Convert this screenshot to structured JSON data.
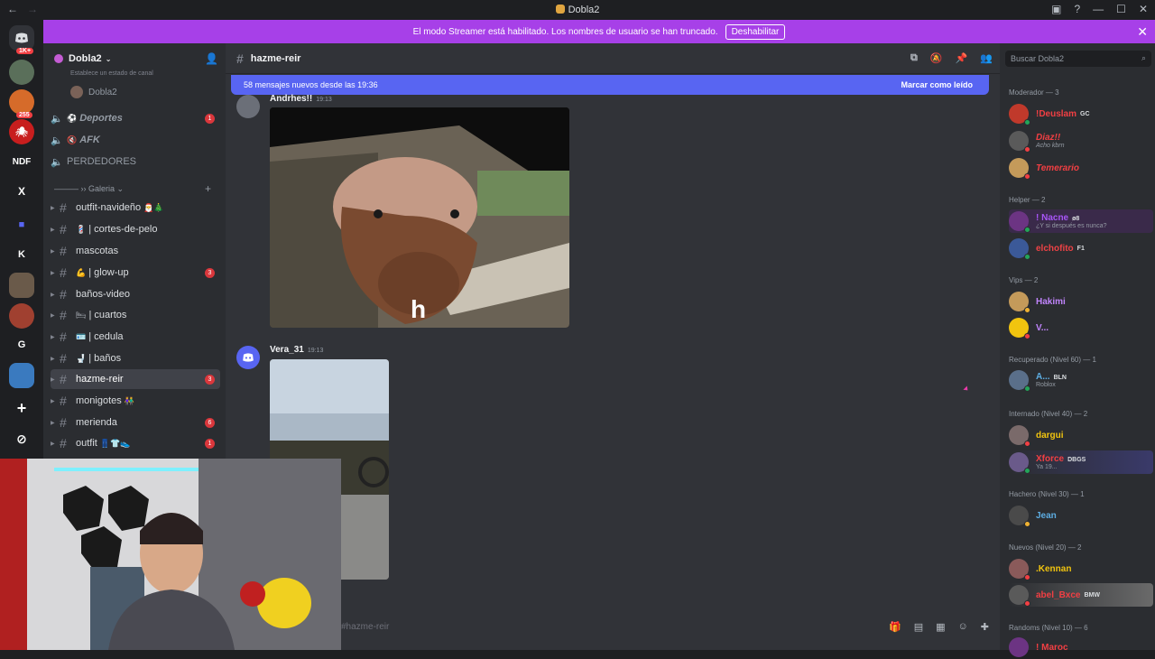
{
  "window": {
    "title": "Dobla2",
    "nav_back": "←",
    "nav_forward": "→"
  },
  "banner": {
    "text": "El modo Streamer está habilitado. Los nombres de usuario se han truncado.",
    "button": "Deshabilitar",
    "close": "✕"
  },
  "guilds": {
    "badges": [
      "1K+",
      "255"
    ],
    "letters": [
      "NDF",
      "X",
      "K",
      "G"
    ],
    "add": "+",
    "explore": "⊘"
  },
  "sidebar": {
    "server_name": "Dobla2",
    "status_hint": "Establece un estado de canal",
    "user": "Dobla2",
    "voice_channels": [
      {
        "label": "Deportes",
        "count": "1"
      },
      {
        "label": "AFK",
        "count": ""
      },
      {
        "label": "PERDEDORES",
        "count": ""
      }
    ],
    "category": "——— ›› Galeria",
    "channels": [
      {
        "label": "outfit-navideño",
        "emoji": "",
        "count": ""
      },
      {
        "label": "| cortes-de-pelo",
        "emoji": "💈",
        "count": ""
      },
      {
        "label": "mascotas",
        "emoji": "",
        "count": ""
      },
      {
        "label": "| glow-up",
        "emoji": "💪",
        "count": "3"
      },
      {
        "label": "baños-video",
        "emoji": "",
        "count": ""
      },
      {
        "label": "| cuartos",
        "emoji": "🛏",
        "count": ""
      },
      {
        "label": "| cedula",
        "emoji": "🪪",
        "count": ""
      },
      {
        "label": "| baños",
        "emoji": "🚽",
        "count": ""
      },
      {
        "label": "hazme-reir",
        "emoji": "",
        "count": "3"
      },
      {
        "label": "monigotes",
        "emoji": "",
        "count": ""
      },
      {
        "label": "merienda",
        "emoji": "",
        "count": "6"
      },
      {
        "label": "outfit",
        "emoji": "",
        "count": "1"
      }
    ]
  },
  "main": {
    "channel": "hazme-reir",
    "new_messages": "58 mensajes nuevos desde las 19:36",
    "mark_read": "Marcar como leído",
    "messages": [
      {
        "author": "Andrhes!!",
        "time": "19:13",
        "caption": "h"
      },
      {
        "author": "Vera_31",
        "time": "19:13"
      }
    ],
    "input_placeholder": "#hazme-reir"
  },
  "members": {
    "search_placeholder": "Buscar Dobla2",
    "groups": [
      {
        "title": "Moderador — 3"
      },
      {
        "title": "Helper — 2"
      },
      {
        "title": "Vips — 2"
      },
      {
        "title": "Recuperado (Nivel 60) — 1"
      },
      {
        "title": "Internado (Nivel 40) — 2"
      },
      {
        "title": "Hachero (Nivel 30) — 1"
      },
      {
        "title": "Nuevos (Nivel 20) — 2"
      },
      {
        "title": "Randoms (Nivel 10) — 6"
      }
    ],
    "list": [
      {
        "name": "!Deuslam",
        "tag": "GC",
        "sub": "",
        "color": "#f23f43"
      },
      {
        "name": "Diaz!!",
        "tag": "",
        "sub": "Acho kbrn",
        "color": "#f23f43"
      },
      {
        "name": "Temerario",
        "tag": "",
        "sub": "",
        "color": "#f23f43"
      },
      {
        "name": "! Nacne",
        "tag": "ø8",
        "sub": "¿Y si después es nunca?",
        "color": "#a855f7"
      },
      {
        "name": "elchofito",
        "tag": "F1",
        "sub": "",
        "color": "#ed4245"
      },
      {
        "name": "Hakimi",
        "tag": "",
        "sub": "",
        "color": "#c084fc"
      },
      {
        "name": "V...",
        "tag": "",
        "sub": "",
        "color": "#c084fc"
      },
      {
        "name": "A...",
        "tag": "BLN",
        "sub": "Roblox",
        "color": "#5dade2"
      },
      {
        "name": "dargui",
        "tag": "",
        "sub": "",
        "color": "#f1c40f"
      },
      {
        "name": "Xforce",
        "tag": "DBGS",
        "sub": "Ya 19...",
        "color": "#f23f43"
      },
      {
        "name": "Jean",
        "tag": "",
        "sub": "",
        "color": "#5dade2"
      },
      {
        "name": ".Kennan",
        "tag": "",
        "sub": "",
        "color": "#f1c40f"
      },
      {
        "name": "abel_Bxce",
        "tag": "BMW",
        "sub": "",
        "color": "#f23f43"
      },
      {
        "name": "! Maroc",
        "tag": "",
        "sub": "",
        "color": "#f23f43"
      }
    ]
  }
}
